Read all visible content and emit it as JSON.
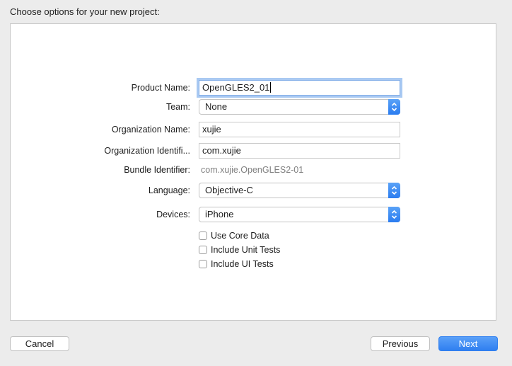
{
  "header": {
    "title": "Choose options for your new project:"
  },
  "form": {
    "product_name": {
      "label": "Product Name:",
      "value": "OpenGLES2_01"
    },
    "team": {
      "label": "Team:",
      "value": "None"
    },
    "organization_name": {
      "label": "Organization Name:",
      "value": "xujie"
    },
    "organization_identifier": {
      "label": "Organization Identifi...",
      "value": "com.xujie"
    },
    "bundle_identifier": {
      "label": "Bundle Identifier:",
      "value": "com.xujie.OpenGLES2-01"
    },
    "language": {
      "label": "Language:",
      "value": "Objective-C"
    },
    "devices": {
      "label": "Devices:",
      "value": "iPhone"
    },
    "checkboxes": [
      {
        "label": "Use Core Data",
        "checked": false
      },
      {
        "label": "Include Unit Tests",
        "checked": false
      },
      {
        "label": "Include UI Tests",
        "checked": false
      }
    ]
  },
  "footer": {
    "cancel_label": "Cancel",
    "previous_label": "Previous",
    "next_label": "Next"
  },
  "colors": {
    "accent": "#2f7ff0",
    "focus_ring": "#a9c9f2",
    "background": "#ececec"
  },
  "icons": {
    "select_arrow": "up-down-chevron-icon"
  }
}
